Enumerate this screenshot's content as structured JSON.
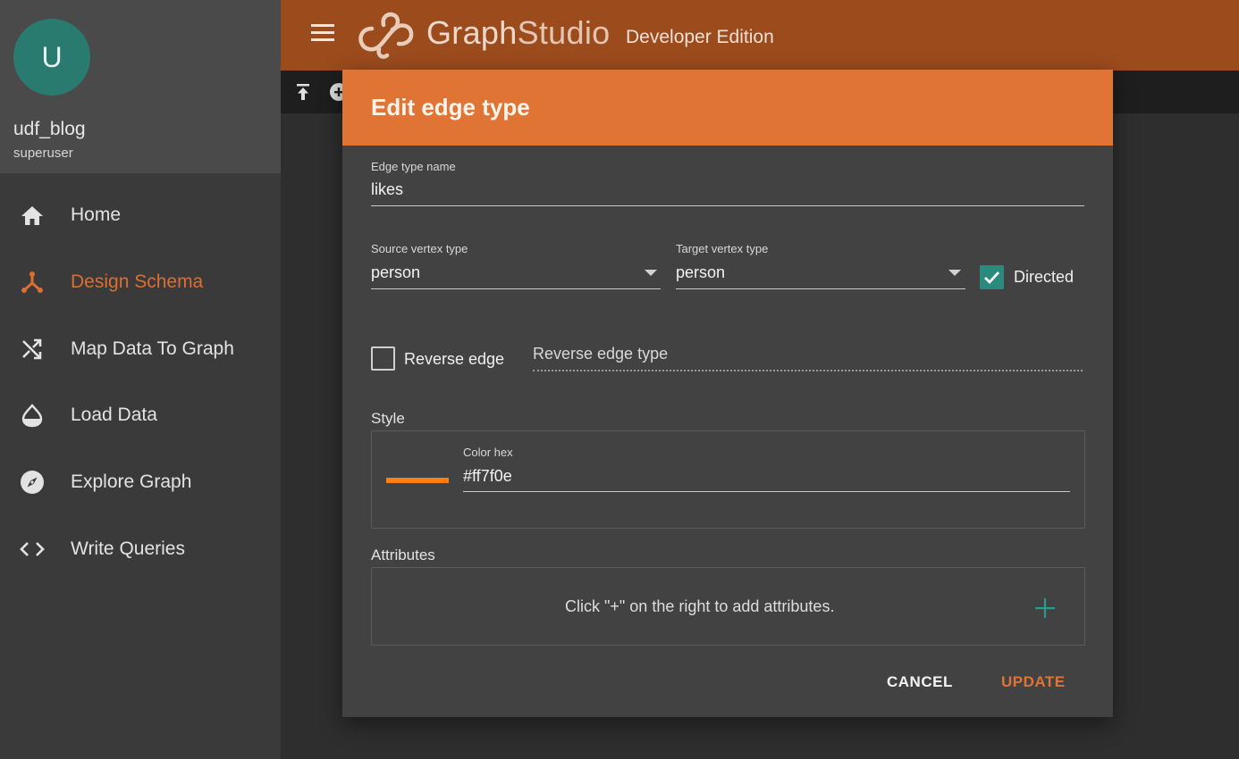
{
  "colors": {
    "accent": "#e07434",
    "active_nav": "#dd6e33",
    "topbar": "#9c4b1d",
    "avatar_bg": "#2a7b6f",
    "checkbox_checked": "#2a8a7d",
    "edge_color": "#ff7f0e"
  },
  "user": {
    "avatar_letter": "U",
    "name": "udf_blog",
    "role": "superuser"
  },
  "nav": {
    "items": [
      {
        "label": "Home",
        "icon": "home-icon"
      },
      {
        "label": "Design Schema",
        "icon": "schema-icon",
        "active": true
      },
      {
        "label": "Map Data To Graph",
        "icon": "shuffle-icon"
      },
      {
        "label": "Load Data",
        "icon": "drop-icon"
      },
      {
        "label": "Explore Graph",
        "icon": "compass-icon"
      },
      {
        "label": "Write Queries",
        "icon": "code-icon"
      }
    ]
  },
  "header": {
    "brand_bold": "Graph",
    "brand_light": "Studio",
    "edition": "Developer Edition"
  },
  "dialog": {
    "title": "Edit edge type",
    "edge_name_label": "Edge type name",
    "edge_name_value": "likes",
    "source_label": "Source vertex type",
    "source_value": "person",
    "target_label": "Target vertex type",
    "target_value": "person",
    "directed_label": "Directed",
    "directed_checked": true,
    "reverse_edge_label": "Reverse edge",
    "reverse_edge_checked": false,
    "reverse_edge_type_placeholder": "Reverse edge type",
    "style_label": "Style",
    "color_hex_label": "Color hex",
    "color_hex_value": "#ff7f0e",
    "attributes_label": "Attributes",
    "attributes_hint": "Click \"+\" on the right to add attributes.",
    "cancel_label": "CANCEL",
    "update_label": "UPDATE"
  }
}
